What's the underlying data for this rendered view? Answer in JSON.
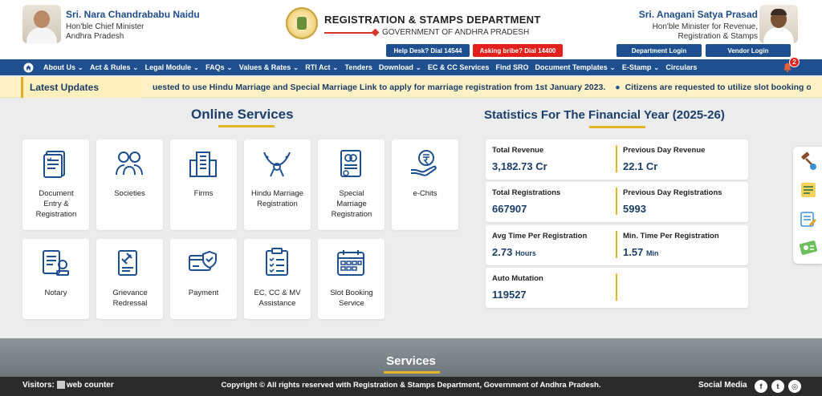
{
  "header": {
    "cm_name": "Sri. Nara Chandrababu Naidu",
    "cm_desc1": "Hon'ble Chief Minister",
    "cm_desc2": "Andhra Pradesh",
    "dept_title": "REGISTRATION & STAMPS DEPARTMENT",
    "govt_title": "GOVERNMENT OF ANDHRA PRADESH",
    "minister_name": "Sri. Anagani Satya Prasad",
    "minister_desc1": "Hon'ble Minister for Revenue,",
    "minister_desc2": "Registration & Stamps",
    "helpdesk": "Help Desk? Dial 14544",
    "bribe": "Asking bribe? Dial 14400",
    "dept_login": "Department Login",
    "vendor_login": "Vendor Login"
  },
  "nav": {
    "items": [
      "About Us ⌄",
      "Act & Rules ⌄",
      "Legal Module ⌄",
      "FAQs ⌄",
      "Values & Rates ⌄",
      "RTI Act ⌄",
      "Tenders",
      "Download ⌄",
      "EC & CC Services",
      "Find SRO",
      "Document Templates ⌄",
      "E-Stamp ⌄",
      "Circulars"
    ],
    "notification_count": "2"
  },
  "updates": {
    "label": "Latest Updates",
    "text1": "uested to use Hindu Marriage and Special Marriage Link to apply for marriage registration from 1st January 2023.",
    "text2": "Citizens are requested to utilize slot booking option."
  },
  "online_services": {
    "title": "Online Services",
    "tiles": [
      {
        "label": "Document Entry & Registration"
      },
      {
        "label": "Societies"
      },
      {
        "label": "Firms"
      },
      {
        "label": "Hindu Marriage Registration"
      },
      {
        "label": "Special Marriage Registration"
      },
      {
        "label": "e-Chits"
      },
      {
        "label": "Notary"
      },
      {
        "label": "Grievance Redressal"
      },
      {
        "label": "Payment"
      },
      {
        "label": "EC, CC & MV Assistance"
      },
      {
        "label": "Slot Booking Service"
      }
    ]
  },
  "statistics": {
    "title": "Statistics For The Financial Year (2025-26)",
    "total_revenue_label": "Total Revenue",
    "total_revenue_value": "3,182.73 Cr",
    "prev_day_revenue_label": "Previous Day Revenue",
    "prev_day_revenue_value": "22.1 Cr",
    "total_reg_label": "Total Registrations",
    "total_reg_value": "667907",
    "prev_day_reg_label": "Previous Day Registrations",
    "prev_day_reg_value": "5993",
    "avg_time_label": "Avg Time Per Registration",
    "avg_time_value": "2.73",
    "avg_time_unit": "Hours",
    "min_time_label": "Min. Time Per Registration",
    "min_time_value": "1.57",
    "min_time_unit": "Min",
    "auto_mutation_label": "Auto Mutation",
    "auto_mutation_value": "119527"
  },
  "services": {
    "title": "Services"
  },
  "footer": {
    "visitors": "Visitors:",
    "counter_alt": "web counter",
    "copyright": "Copyright © All rights reserved with Registration & Stamps Department, Government of Andhra Pradesh.",
    "social_label": "Social Media",
    "social_fb": "f",
    "social_tw": "t",
    "social_ig": "◎"
  },
  "colors": {
    "primary": "#1f4f8f",
    "accent": "#e6b325",
    "danger": "#e3201b"
  }
}
